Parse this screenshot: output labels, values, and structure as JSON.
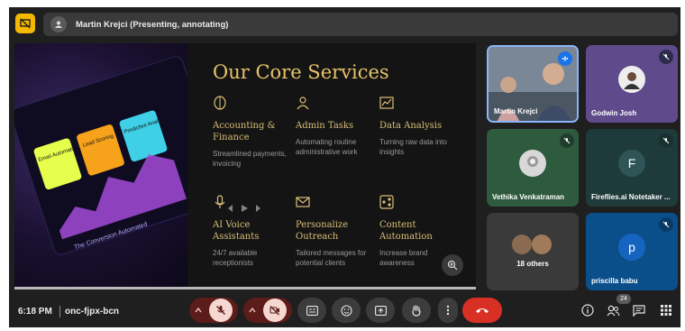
{
  "presenter": {
    "label": "Martin Krejci (Presenting, annotating)"
  },
  "slide": {
    "title": "Our Core Services",
    "services": [
      {
        "icon": "brain-icon",
        "name": "Accounting & Finance",
        "desc": "Streamlined payments, invoicing"
      },
      {
        "icon": "worker-icon",
        "name": "Admin Tasks",
        "desc": "Automating routine administrative work"
      },
      {
        "icon": "chart-icon",
        "name": "Data Analysis",
        "desc": "Turning raw data into insights"
      },
      {
        "icon": "microphone-icon",
        "name": "AI Voice Assistants",
        "desc": "24/7 available receptionists"
      },
      {
        "icon": "envelope-icon",
        "name": "Personalize Outreach",
        "desc": "Tailored messages for potential clients"
      },
      {
        "icon": "share-icon",
        "name": "Content Automation",
        "desc": "Increase brand awareness"
      }
    ],
    "photo_text": {
      "card1": "Email Automation",
      "card2": "Lead Scoring",
      "card3": "Predictive Analytics",
      "caption": "The Conversion Automated"
    },
    "progress": 1.0
  },
  "participants": [
    {
      "name": "Martin Krejci",
      "speaking": true
    },
    {
      "name": "Godwin Josh",
      "muted": true
    },
    {
      "name": "Vethika Venkatraman",
      "muted": true
    },
    {
      "name": "Fireflies.ai Notetaker ...",
      "initial": "F",
      "muted": true
    },
    {
      "name": "18 others"
    },
    {
      "name": "priscilla babu",
      "initial": "p",
      "muted": true
    }
  ],
  "bottom": {
    "time": "6:18 PM",
    "meeting_code": "onc-fjpx-bcn",
    "people_count": "24"
  },
  "colors": {
    "accent_gold": "#e8c46a",
    "end_call": "#d93025",
    "tile_godwin": "#5f4b8b",
    "tile_vethika": "#2e5a3e",
    "tile_fireflies": "#1f3a3a",
    "tile_priscilla": "#0b4f8a"
  }
}
